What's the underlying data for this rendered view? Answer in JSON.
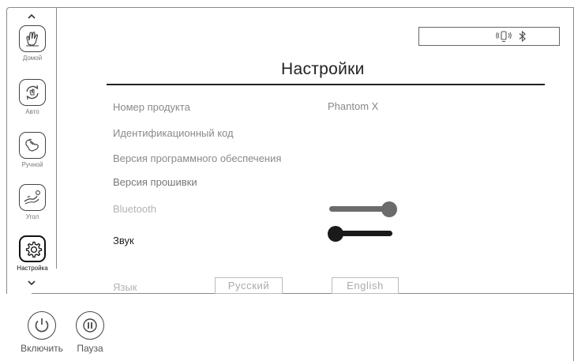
{
  "sidebar": {
    "items": [
      {
        "label": "Домой",
        "icon": "home-hand-icon"
      },
      {
        "label": "Авто",
        "icon": "auto-cycle-icon"
      },
      {
        "label": "Ручной",
        "icon": "manual-hand-icon"
      },
      {
        "label": "Угол",
        "icon": "angle-recline-icon"
      },
      {
        "label": "Настройка",
        "icon": "gear-icon",
        "active": true
      }
    ]
  },
  "controls": {
    "power_label": "Включить",
    "pause_label": "Пауза"
  },
  "status": {
    "icons": [
      "vibrate-icon",
      "bluetooth-icon"
    ]
  },
  "page": {
    "title": "Настройки"
  },
  "settings": {
    "product_number_label": "Номер продукта",
    "product_number_value": "Phantom X",
    "id_code_label": "Идентификационный код",
    "software_version_label": "Версия программного обеспечения",
    "firmware_version_label": "Версия прошивки",
    "bluetooth_label": "Bluetooth",
    "bluetooth_level": 1.0,
    "sound_label": "Звук",
    "sound_level": 0.0,
    "language_label": "Язык",
    "language_options": [
      "Русский",
      "English"
    ]
  },
  "colors": {
    "text_dark": "#222222",
    "text_muted": "#8a8a8a",
    "slider_gray": "#6b6b6b",
    "slider_dark": "#1a1a1a"
  }
}
